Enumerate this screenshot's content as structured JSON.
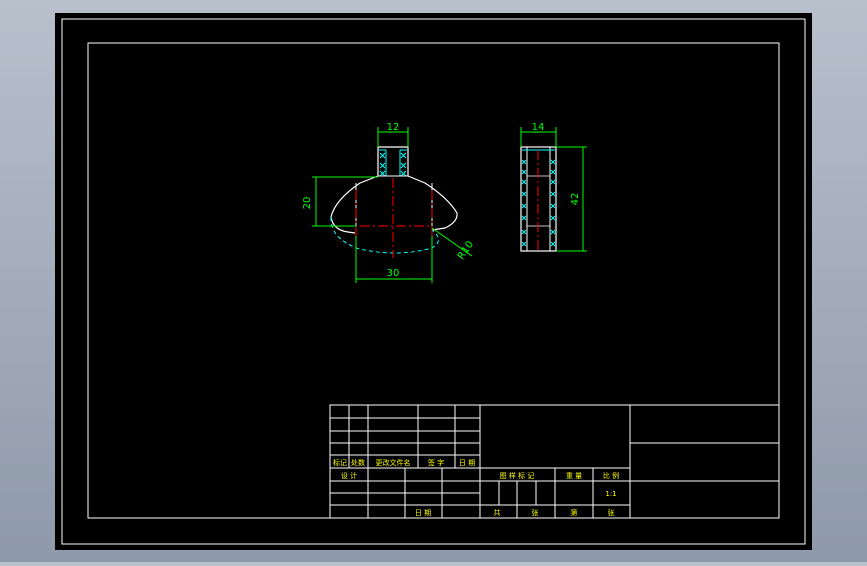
{
  "colors": {
    "background": "#000000",
    "frame": "#ffffff",
    "dimension": "#00ff00",
    "outline": "#ffffff",
    "hatch": "#00ffff",
    "center_line": "#ff0000",
    "title_text": "#ffff00"
  },
  "dimensions": {
    "front_top_width": "12",
    "front_height": "20",
    "front_bottom_width": "30",
    "front_radius": "R10",
    "side_width": "14",
    "side_height": "42"
  },
  "title_block": {
    "rev_mark": "标记",
    "rev_count": "处数",
    "rev_file": "更改文件名",
    "rev_sign": "签 字",
    "rev_date": "日 期",
    "designer": "设 计",
    "date": "日 期",
    "stage_mark": "图 样 标 记",
    "weight": "重 量",
    "scale_label": "比 例",
    "scale_value": "1:1",
    "total": "共",
    "sheet_unit_1": "张",
    "sheet_no": "第",
    "sheet_unit_2": "张"
  }
}
